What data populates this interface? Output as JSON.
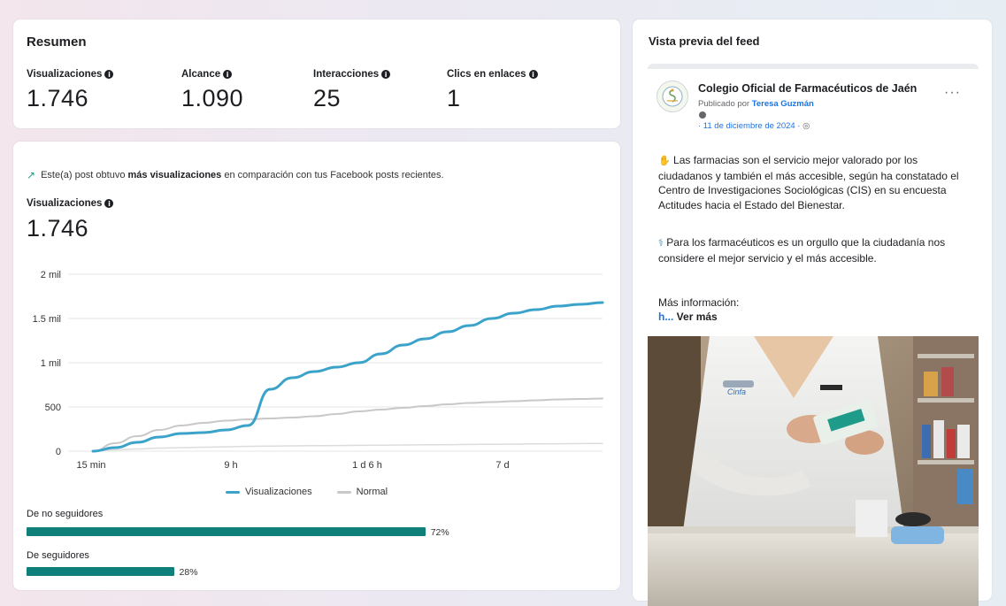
{
  "summary": {
    "title": "Resumen",
    "metrics": [
      {
        "label": "Visualizaciones",
        "value": "1.746"
      },
      {
        "label": "Alcance",
        "value": "1.090"
      },
      {
        "label": "Interacciones",
        "value": "25"
      },
      {
        "label": "Clics en enlaces",
        "value": "1"
      }
    ]
  },
  "insight": {
    "prefix": "Este(a) post obtuvo ",
    "bold": "más visualizaciones",
    "suffix": " en comparación con tus Facebook posts recientes."
  },
  "views": {
    "label": "Visualizaciones",
    "value": "1.746"
  },
  "chart_data": {
    "type": "line",
    "x_tick_labels": [
      "15 min",
      "9 h",
      "1 d 6 h",
      "7 d"
    ],
    "y_tick_labels": [
      "0",
      "500",
      "1 mil",
      "1.5 mil",
      "2 mil"
    ],
    "ylim": [
      0,
      2000
    ],
    "grid": true,
    "legend_position": "bottom",
    "series": [
      {
        "name": "Visualizaciones",
        "color": "#3ba3c9",
        "values": [
          0,
          40,
          100,
          160,
          200,
          210,
          240,
          290,
          700,
          830,
          900,
          950,
          1000,
          1100,
          1200,
          1270,
          1350,
          1420,
          1500,
          1560,
          1600,
          1640,
          1660,
          1680
        ]
      },
      {
        "name": "Normal",
        "color": "#c8c8c8",
        "values": [
          0,
          90,
          170,
          240,
          290,
          320,
          345,
          360,
          370,
          380,
          395,
          420,
          450,
          470,
          490,
          510,
          530,
          545,
          555,
          565,
          575,
          585,
          590,
          595
        ]
      }
    ],
    "lower_band_values": [
      0,
      15,
      25,
      35,
      40,
      45,
      50,
      55,
      58,
      60,
      62,
      64,
      66,
      68,
      70,
      72,
      74,
      76,
      78,
      80,
      82,
      84,
      86,
      88
    ]
  },
  "legend": {
    "views": "Visualizaciones",
    "normal": "Normal"
  },
  "audience": {
    "non_followers": {
      "label": "De no seguidores",
      "pct_text": "72%",
      "pct": 72
    },
    "followers": {
      "label": "De seguidores",
      "pct_text": "28%",
      "pct": 28
    }
  },
  "feed": {
    "title": "Vista previa del feed",
    "page_name": "Colegio Oficial de Farmacéuticos de Jaén",
    "published_prefix": "Publicado por ",
    "author": "Teresa Guzmán",
    "date": "· 11 de diciembre de 2024 ·",
    "more": "···",
    "para1": "Las farmacias son el servicio mejor valorado por los ciudadanos y también el más accesible, según ha constatado el Centro de Investigaciones Sociológicas (CIS) en su encuesta Actitudes hacia el Estado del Bienestar.",
    "para2": "Para los farmacéuticos es un orgullo que la ciudadanía nos considere el mejor servicio y el más accesible.",
    "more_info": "Más información:",
    "link_char": "h...",
    "see_more": " Ver más",
    "coat_text": "Cinfa"
  },
  "colors": {
    "accent": "#0e7f79",
    "views_line": "#3ba3c9",
    "normal_line": "#c8c8c8",
    "link": "#1b74e4"
  }
}
